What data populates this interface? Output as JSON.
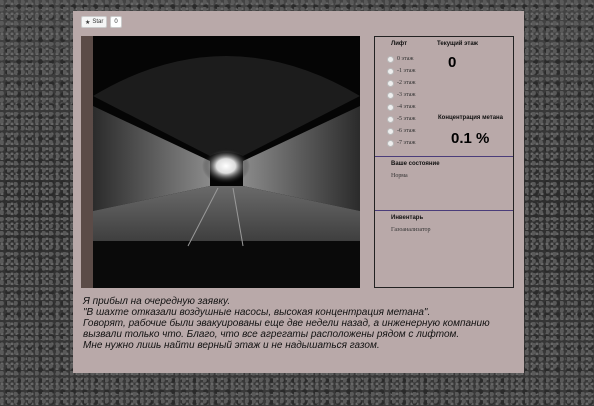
{
  "github": {
    "star_label": "Star",
    "star_count": "0"
  },
  "sidebar": {
    "lift": {
      "title": "Лифт",
      "floors": [
        "0 этаж",
        "-1 этаж",
        "-2 этаж",
        "-3 этаж",
        "-4 этаж",
        "-5 этаж",
        "-6 этаж",
        "-7 этаж"
      ]
    },
    "current_floor": {
      "title": "Текущий этаж",
      "value": "0"
    },
    "methane": {
      "title": "Концентрация метана",
      "value": "0.1  %"
    },
    "state": {
      "title": "Ваше состояние",
      "value": "Норма"
    },
    "inventory": {
      "title": "Инвентарь",
      "value": "Газоанализатор"
    }
  },
  "story": [
    "Я прибыл на очередную заявку.",
    "\"В шахте отказали воздушные насосы, высокая концентрация метана\".",
    "Говорят, рабочие были эвакуированы еще две недели назад, а инженерную компанию вызвали только что. Благо, что все агрегаты расположены рядом с лифтом.",
    "Мне нужно лишь найти верный этаж и не надышаться газом."
  ]
}
